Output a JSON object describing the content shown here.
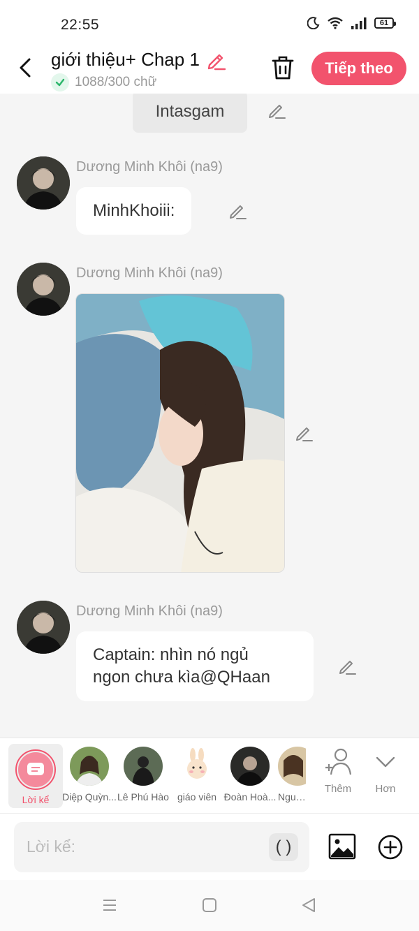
{
  "status_bar": {
    "time": "22:55",
    "battery": "61"
  },
  "header": {
    "title": "giới thiệu+ Chap 1",
    "word_count": "1088/300 chữ",
    "next_label": "Tiếp theo",
    "accent_color": "#f2536d"
  },
  "messages": [
    {
      "type": "narration",
      "text": "Intasgam"
    },
    {
      "type": "text",
      "sender": "Dương Minh Khôi (na9)",
      "text": "MinhKhoiii:"
    },
    {
      "type": "image",
      "sender": "Dương Minh Khôi (na9)"
    },
    {
      "type": "text",
      "sender": "Dương Minh Khôi (na9)",
      "text_line1": "Captain: nhìn nó ngủ",
      "text_line2": "ngon chưa kìa@QHaan"
    }
  ],
  "characters": [
    {
      "label": "Lời kể",
      "selected": true
    },
    {
      "label": "Diệp Quỳn..."
    },
    {
      "label": "Lê Phú Hào"
    },
    {
      "label": "giáo viên"
    },
    {
      "label": "Đoàn Hoà..."
    },
    {
      "label": "Nguyễ"
    }
  ],
  "actions": {
    "add_label": "Thêm",
    "more_label": "Hơn"
  },
  "input": {
    "placeholder": "Lời kể:",
    "paren": "( )"
  },
  "icons": [
    "back-icon",
    "pencil-icon",
    "check-icon",
    "trash-icon",
    "image-icon",
    "plus-circle-icon",
    "add-person-icon",
    "chevron-down-icon",
    "menu-icon",
    "home-icon",
    "back-triangle-icon"
  ]
}
